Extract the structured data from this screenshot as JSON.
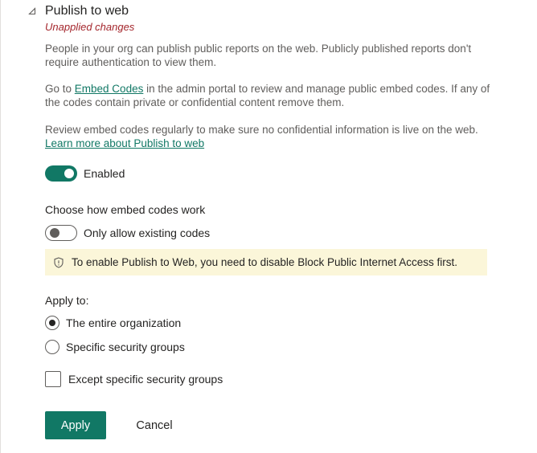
{
  "colors": {
    "accent": "#117865",
    "error_text": "#a4262c",
    "warning_bg": "#fbf6d9",
    "body_text": "#605e5c",
    "primary_text": "#252423"
  },
  "header": {
    "collapse_icon": "triangle-collapse-icon",
    "title": "Publish to web",
    "status": "Unapplied changes"
  },
  "description": {
    "para1": "People in your org can publish public reports on the web. Publicly published reports don't require authentication to view them.",
    "para2_prefix": "Go to ",
    "para2_link": "Embed Codes",
    "para2_suffix": " in the admin portal to review and manage public embed codes. If any of the codes contain private or confidential content remove them.",
    "para3_prefix": "Review embed codes regularly to make sure no confidential information is live on the web. ",
    "para3_link": "Learn more about Publish to web"
  },
  "enabled_toggle": {
    "label": "Enabled",
    "on": true
  },
  "embed_codes": {
    "heading": "Choose how embed codes work",
    "toggle_label": "Only allow existing codes",
    "toggle_on": false
  },
  "warning": {
    "icon": "shield-icon",
    "text": "To enable Publish to Web, you need to disable Block Public Internet Access first."
  },
  "apply_to": {
    "heading": "Apply to:",
    "options": [
      {
        "label": "The entire organization",
        "selected": true
      },
      {
        "label": "Specific security groups",
        "selected": false
      }
    ],
    "except_label": "Except specific security groups",
    "except_checked": false
  },
  "actions": {
    "apply_label": "Apply",
    "cancel_label": "Cancel"
  }
}
